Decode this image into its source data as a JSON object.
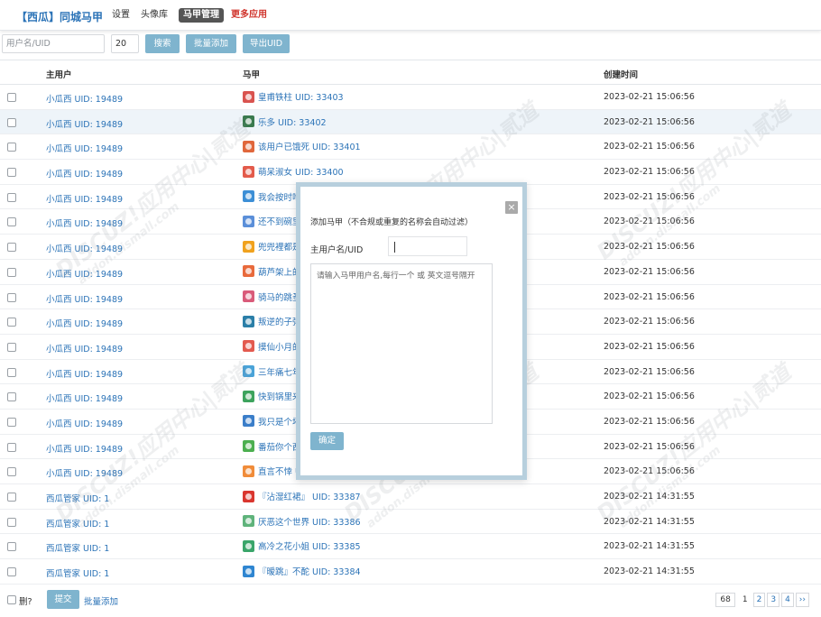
{
  "header": {
    "brand": "【西瓜】同城马甲",
    "nav": [
      {
        "label": "设置",
        "style": "normal"
      },
      {
        "label": "头像库",
        "style": "normal"
      },
      {
        "label": "马甲管理",
        "style": "active"
      },
      {
        "label": "更多应用",
        "style": "red"
      }
    ]
  },
  "toolbar": {
    "search_placeholder": "用户名/UID",
    "count_value": "20",
    "search_label": "搜索",
    "batch_add_label": "批量添加",
    "export_label": "导出UID"
  },
  "table": {
    "columns": {
      "main_user": "主用户",
      "alt": "马甲",
      "created": "创建时间"
    },
    "rows": [
      {
        "user": "小瓜西 UID: 19489",
        "alt": "皇甫铁柱 UID: 33403",
        "time": "2023-02-21 15:06:56",
        "avatar_color": "#d9534f"
      },
      {
        "user": "小瓜西 UID: 19489",
        "alt": "乐多 UID: 33402",
        "time": "2023-02-21 15:06:56",
        "avatar_color": "#3a7a4e"
      },
      {
        "user": "小瓜西 UID: 19489",
        "alt": "该用户已饿死 UID: 33401",
        "time": "2023-02-21 15:06:56",
        "avatar_color": "#e0673c"
      },
      {
        "user": "小瓜西 UID: 19489",
        "alt": "萌呆淑女 UID: 33400",
        "time": "2023-02-21 15:06:56",
        "avatar_color": "#e35b4b"
      },
      {
        "user": "小瓜西 UID: 19489",
        "alt": "我会按时吃",
        "time": "2023-02-21 15:06:56",
        "avatar_color": "#3d8fd6"
      },
      {
        "user": "小瓜西 UID: 19489",
        "alt": "还不到碗里",
        "time": "2023-02-21 15:06:56",
        "avatar_color": "#5b8fd9"
      },
      {
        "user": "小瓜西 UID: 19489",
        "alt": "兜兜裡都是",
        "time": "2023-02-21 15:06:56",
        "avatar_color": "#f0a21e"
      },
      {
        "user": "小瓜西 UID: 19489",
        "alt": "葫芦架上的",
        "time": "2023-02-21 15:06:56",
        "avatar_color": "#e86a3c"
      },
      {
        "user": "小瓜西 UID: 19489",
        "alt": "骑马的跳蚤",
        "time": "2023-02-21 15:06:56",
        "avatar_color": "#d95b7a"
      },
      {
        "user": "小瓜西 UID: 19489",
        "alt": "叛逆的子弹",
        "time": "2023-02-21 15:06:56",
        "avatar_color": "#2b7fa8"
      },
      {
        "user": "小瓜西 UID: 19489",
        "alt": "摸仙小月的",
        "time": "2023-02-21 15:06:56",
        "avatar_color": "#e35a4f"
      },
      {
        "user": "小瓜西 UID: 19489",
        "alt": "三年痛七年",
        "time": "2023-02-21 15:06:56",
        "avatar_color": "#4aa3d8"
      },
      {
        "user": "小瓜西 UID: 19489",
        "alt": "快到锅里来",
        "time": "2023-02-21 15:06:56",
        "avatar_color": "#3da35d"
      },
      {
        "user": "小瓜西 UID: 19489",
        "alt": "我只是个坏",
        "time": "2023-02-21 15:06:56",
        "avatar_color": "#3b7ec9"
      },
      {
        "user": "小瓜西 UID: 19489",
        "alt": "番茄你个西",
        "time": "2023-02-21 15:06:56",
        "avatar_color": "#4caf50"
      },
      {
        "user": "小瓜西 UID: 19489",
        "alt": "直言不悻 U",
        "time": "2023-02-21 15:06:56",
        "avatar_color": "#f08c3a"
      },
      {
        "user": "西瓜管家 UID: 1",
        "alt": "『沾湿红裙』 UID: 33387",
        "time": "2023-02-21 14:31:55",
        "avatar_color": "#d9362f"
      },
      {
        "user": "西瓜管家 UID: 1",
        "alt": "厌恶这个世界 UID: 33386",
        "time": "2023-02-21 14:31:55",
        "avatar_color": "#5fb37b"
      },
      {
        "user": "西瓜管家 UID: 1",
        "alt": "高冷之花小姐 UID: 33385",
        "time": "2023-02-21 14:31:55",
        "avatar_color": "#3aa56a"
      },
      {
        "user": "西瓜管家 UID: 1",
        "alt": "『暧跳』不酡 UID: 33384",
        "time": "2023-02-21 14:31:55",
        "avatar_color": "#2f86d1"
      }
    ]
  },
  "footer": {
    "delete_label": "删?",
    "submit_label": "提交",
    "batch_add_label": "批量添加",
    "pager": {
      "total": "68",
      "current": "1",
      "pages": [
        "2",
        "3",
        "4",
        "››"
      ]
    }
  },
  "modal": {
    "close_glyph": "×",
    "title": "添加马甲（不合规或重复的名称会自动过滤）",
    "main_user_label": "主用户名/UID",
    "textarea_placeholder": "请输入马甲用户名,每行一个 或 英文逗号隔开",
    "confirm_label": "确定"
  },
  "watermark": {
    "text": "DISCUZ!应用中心|贰道",
    "sub": "addon.dismall.com"
  }
}
